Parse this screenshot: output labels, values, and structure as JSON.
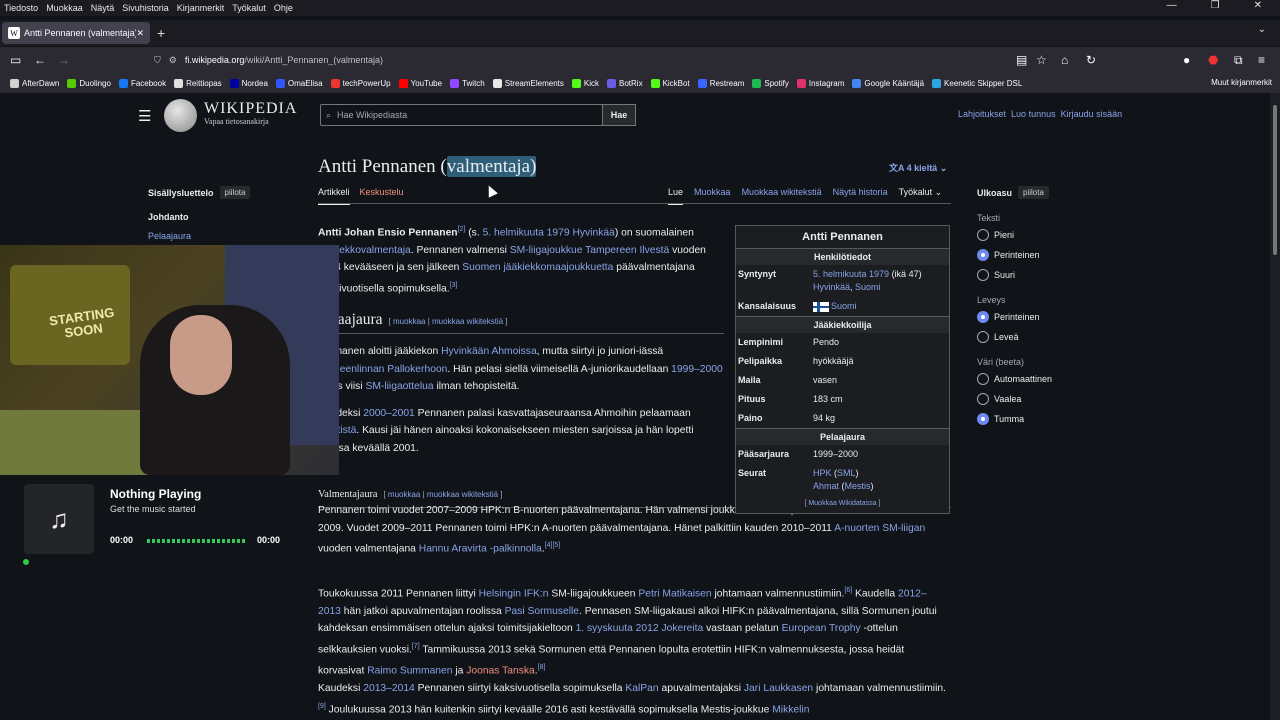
{
  "menubar": [
    "Tiedosto",
    "Muokkaa",
    "Näytä",
    "Sivuhistoria",
    "Kirjanmerkit",
    "Työkalut",
    "Ohje"
  ],
  "tab": {
    "favicon": "W",
    "title": "Antti Pennanen (valmentaja) – W",
    "close": "✕"
  },
  "url": {
    "domain": "fi.wikipedia.org",
    "path": "/wiki/Antti_Pennanen_(valmentaja)"
  },
  "bookmarks": [
    {
      "label": "AfterDawn",
      "color": "#d0d0d0"
    },
    {
      "label": "Duolingo",
      "color": "#58cc02"
    },
    {
      "label": "Facebook",
      "color": "#1877f2"
    },
    {
      "label": "Reittiopas",
      "color": "#e0e0e0"
    },
    {
      "label": "Nordea",
      "color": "#0000a0"
    },
    {
      "label": "OmaElisa",
      "color": "#3355ff"
    },
    {
      "label": "techPowerUp",
      "color": "#e33"
    },
    {
      "label": "YouTube",
      "color": "#ff0000"
    },
    {
      "label": "Twitch",
      "color": "#9146ff"
    },
    {
      "label": "StreamElements",
      "color": "#e8e8e8"
    },
    {
      "label": "Kick",
      "color": "#53fc18"
    },
    {
      "label": "BotRix",
      "color": "#6c5ce7"
    },
    {
      "label": "KickBot",
      "color": "#53fc18"
    },
    {
      "label": "Restream",
      "color": "#3a66ff"
    },
    {
      "label": "Spotify",
      "color": "#1db954"
    },
    {
      "label": "Instagram",
      "color": "#e1306c"
    },
    {
      "label": "Google Kääntäjä",
      "color": "#4285f4"
    },
    {
      "label": "Keenetic Skipper DSL",
      "color": "#2aa7e0"
    }
  ],
  "bookmarks_other": "Muut kirjanmerkit",
  "wiki": {
    "wordmark": "WIKIPEDIA",
    "tagline": "Vapaa tietosanakirja",
    "search_placeholder": "Hae Wikipediasta",
    "search_button": "Hae",
    "user_links": [
      "Lahjoitukset",
      "Luo tunnus",
      "Kirjaudu sisään"
    ],
    "title_main": "Antti Pennanen (",
    "title_sel": "valmentaja)",
    "languages": "4 kieltä",
    "tabs_left": [
      "Artikkeli",
      "Keskustelu"
    ],
    "tabs_right": [
      "Lue",
      "Muokkaa",
      "Muokkaa wikitekstiä",
      "Näytä historia",
      "Työkalut"
    ],
    "toc_title": "Sisällysluettelo",
    "hide": "piilota",
    "toc": [
      "Johdanto",
      "Pelaajaura"
    ],
    "appearance": {
      "title": "Ulkoasu",
      "hide": "piilota",
      "groups": [
        {
          "label": "Teksti",
          "options": [
            "Pieni",
            "Perinteinen",
            "Suuri"
          ],
          "selected": 1
        },
        {
          "label": "Leveys",
          "options": [
            "Perinteinen",
            "Leveä"
          ],
          "selected": 0
        },
        {
          "label": "Väri (beeta)",
          "options": [
            "Automaattinen",
            "Vaalea",
            "Tumma"
          ],
          "selected": 2
        }
      ]
    }
  },
  "infobox": {
    "title": "Antti Pennanen",
    "sec1": "Henkilötiedot",
    "born_label": "Syntynyt",
    "born_date": "5. helmikuuta 1979",
    "born_age": " (ikä 47)",
    "born_place1": "Hyvinkää",
    "born_place2": "Suomi",
    "nation_label": "Kansalaisuus",
    "nation": "Suomi",
    "sec2": "Jääkiekkoilija",
    "rows": [
      [
        "Lempinimi",
        "Pendo"
      ],
      [
        "Pelipaikka",
        "hyökkääjä"
      ],
      [
        "Maila",
        "vasen"
      ],
      [
        "Pituus",
        "183 cm"
      ],
      [
        "Paino",
        "94 kg"
      ]
    ],
    "sec3": "Pelaajaura",
    "career_label": "Pääsarjaura",
    "career": "1999–2000",
    "clubs_label": "Seurat",
    "club1": "HPK",
    "club1b": "SML",
    "club2": "Ahmat",
    "club2b": "Mestis",
    "foot": "Muokkaa Wikidatassa"
  },
  "music": {
    "title": "Nothing Playing",
    "subtitle": "Get the music started",
    "t_start": "00:00",
    "t_end": "00:00"
  }
}
